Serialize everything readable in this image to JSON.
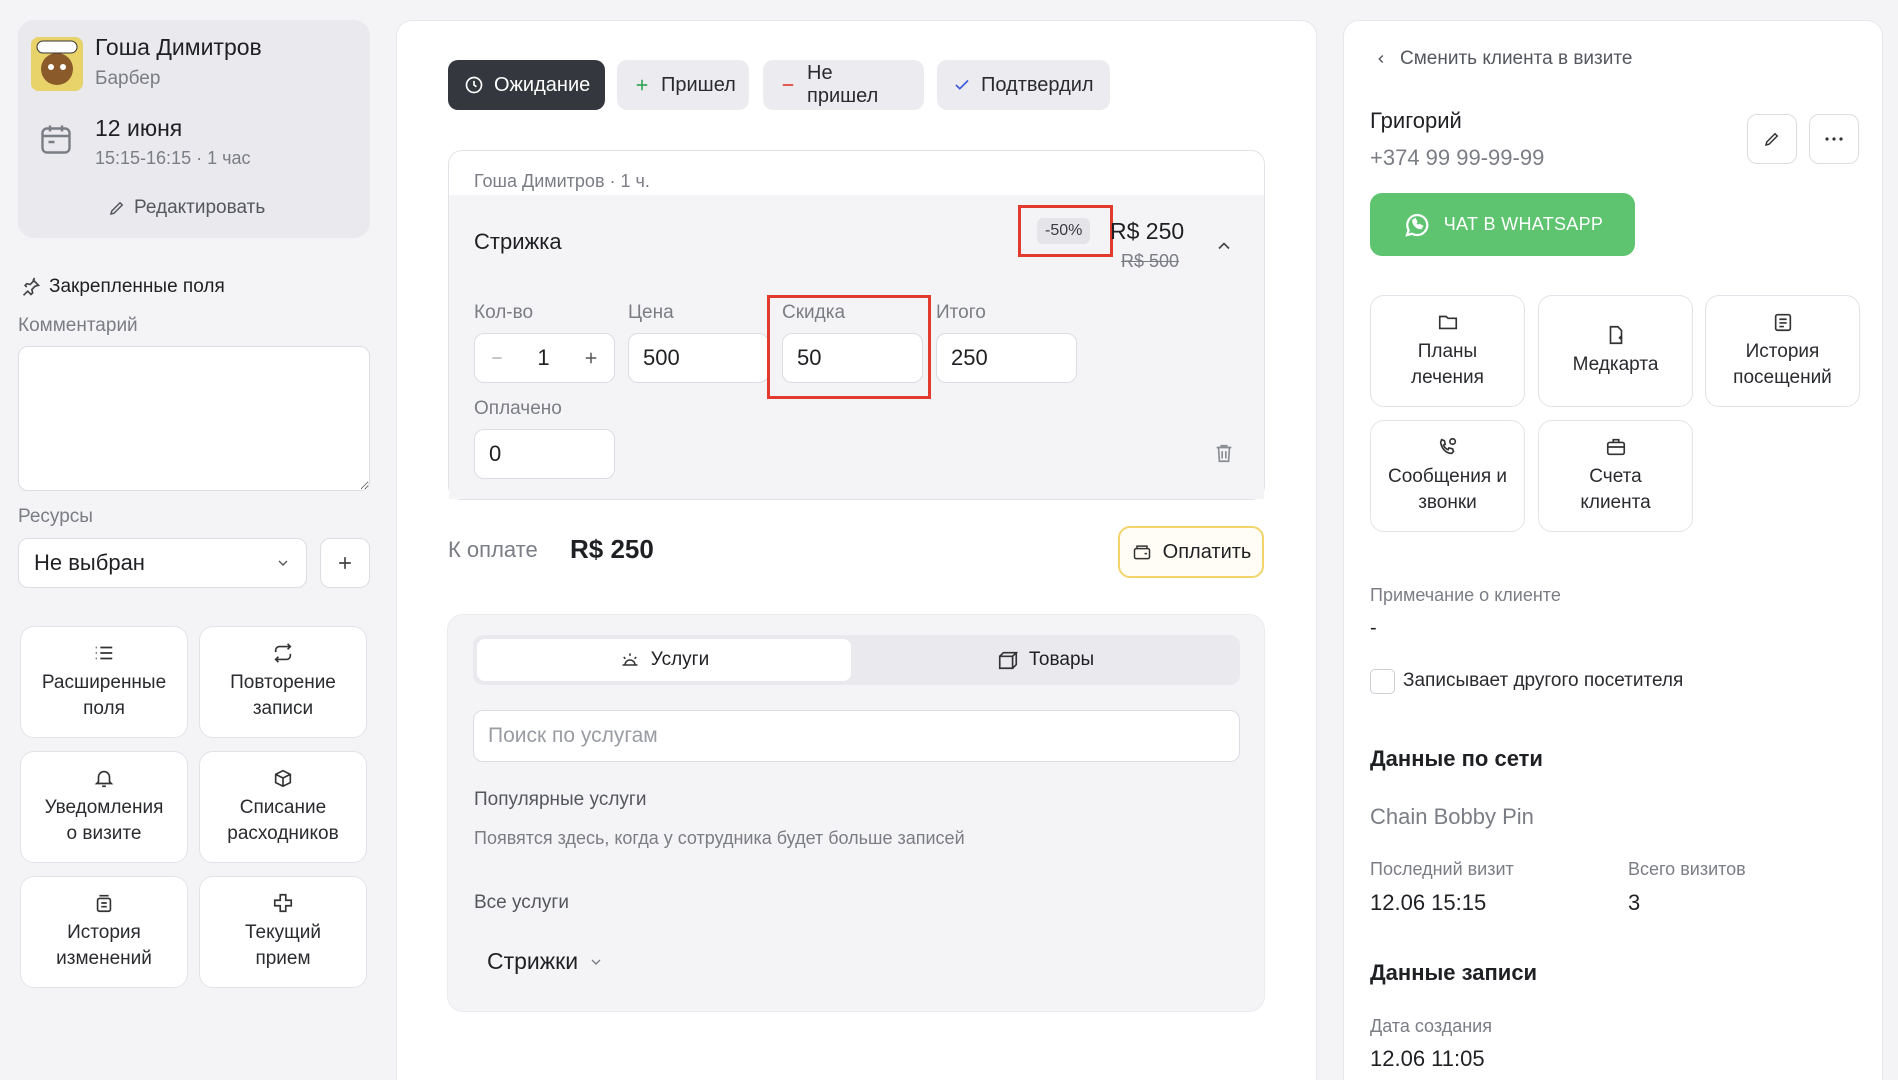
{
  "visit": {
    "staff_name": "Гоша Димитров",
    "staff_role": "Барбер",
    "date": "12 июня",
    "time": "15:15-16:15 · 1 час",
    "edit_label": "Редактировать"
  },
  "left": {
    "pinned_title": "Закрепленные поля",
    "comment_label": "Комментарий",
    "comment_value": "",
    "resources_label": "Ресурсы",
    "resources_value": "Не выбран",
    "tiles": [
      {
        "label1": "Расширенные",
        "label2": "поля",
        "icon": "list-icon"
      },
      {
        "label1": "Повторение",
        "label2": "записи",
        "icon": "repeat-icon"
      },
      {
        "label1": "Уведомления",
        "label2": "о визите",
        "icon": "bell-icon"
      },
      {
        "label1": "Списание",
        "label2": "расходников",
        "icon": "boxes-icon"
      },
      {
        "label1": "История",
        "label2": "изменений",
        "icon": "history-icon"
      },
      {
        "label1": "Текущий",
        "label2": "прием",
        "icon": "medical-cross-icon"
      }
    ]
  },
  "status": {
    "waiting": "Ожидание",
    "arrived": "Пришел",
    "no_show": "Не пришел",
    "confirmed": "Подтвердил",
    "active": "waiting"
  },
  "service": {
    "header": "Гоша Димитров · 1 ч.",
    "name": "Стрижка",
    "discount_badge": "-50%",
    "price": "R$ 250",
    "old_price": "R$ 500",
    "qty_label": "Кол-во",
    "qty": "1",
    "price_label": "Цена",
    "price_value": "500",
    "discount_label": "Скидка",
    "discount_value": "50",
    "total_label": "Итого",
    "total_value": "250",
    "paid_label": "Оплачено",
    "paid_value": "0"
  },
  "payment": {
    "due_label": "К оплате",
    "due_amount": "R$ 250",
    "pay_button": "Оплатить"
  },
  "catalog": {
    "tab_services": "Услуги",
    "tab_goods": "Товары",
    "search_placeholder": "Поиск по услугам",
    "popular_title": "Популярные услуги",
    "popular_hint": "Появятся здесь, когда у сотрудника будет больше записей",
    "all_title": "Все услуги",
    "category": "Стрижки"
  },
  "client": {
    "change_link": "Сменить клиента в визите",
    "name": "Григорий",
    "phone": "+374 99 99-99-99",
    "whatsapp_button": "ЧАТ В WHATSAPP",
    "tiles": [
      {
        "label1": "Планы",
        "label2": "лечения",
        "icon": "folder-icon"
      },
      {
        "label1": "Медкарта",
        "label2": "",
        "icon": "medical-file-icon"
      },
      {
        "label1": "История",
        "label2": "посещений",
        "icon": "visits-icon"
      },
      {
        "label1": "Сообщения и",
        "label2": "звонки",
        "icon": "phone-chat-icon"
      },
      {
        "label1": "Счета",
        "label2": "клиента",
        "icon": "briefcase-icon"
      }
    ],
    "note_label": "Примечание о клиенте",
    "note_value": "-",
    "other_visitor_label": "Записывает другого посетителя",
    "network_title": "Данные по сети",
    "network_name": "Chain Bobby Pin",
    "last_visit_label": "Последний визит",
    "last_visit_value": "12.06 15:15",
    "total_visits_label": "Всего визитов",
    "total_visits_value": "3",
    "record_title": "Данные записи",
    "created_label": "Дата создания",
    "created_value": "12.06 11:05"
  },
  "colors": {
    "active_status_bg": "#34373d",
    "whatsapp_green": "#5ec46f",
    "highlight_red": "#e23b2e",
    "pay_border": "#f2d46a"
  }
}
